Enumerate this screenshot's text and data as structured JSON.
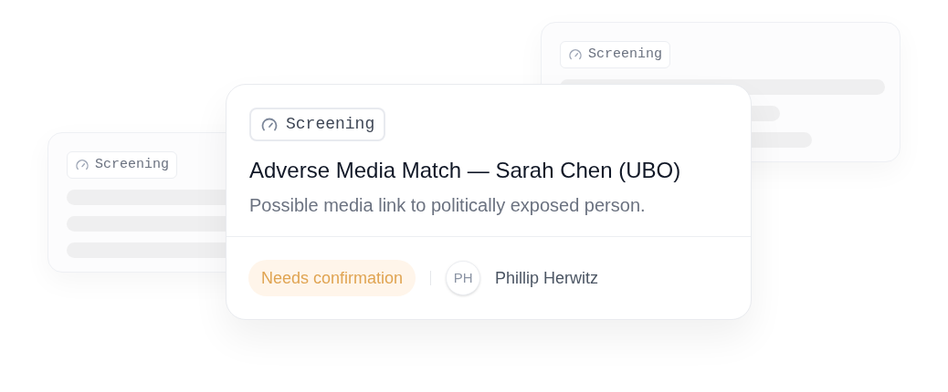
{
  "background_cards": [
    {
      "tag": "Screening"
    },
    {
      "tag": "Screening"
    }
  ],
  "card": {
    "tag": "Screening",
    "title": "Adverse Media Match — Sarah Chen (UBO)",
    "description": "Possible media link to politically exposed person.",
    "status": "Needs confirmation",
    "assignee": {
      "initials": "PH",
      "name": "Phillip Herwitz"
    }
  }
}
